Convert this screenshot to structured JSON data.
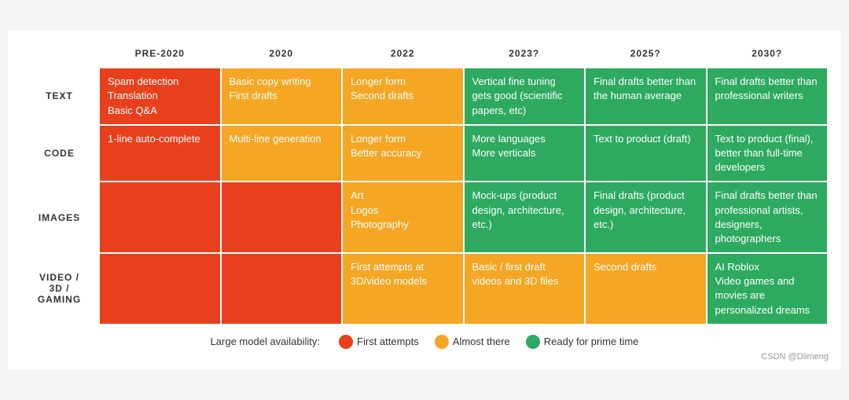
{
  "table": {
    "headers": [
      "PRE-2020",
      "2020",
      "2022",
      "2023?",
      "2025?",
      "2030?"
    ],
    "rows": [
      {
        "label": "TEXT",
        "cells": [
          {
            "color": "red",
            "text": "Spam detection\nTranslation\nBasic Q&A"
          },
          {
            "color": "orange",
            "text": "Basic copy writing\nFirst drafts"
          },
          {
            "color": "orange",
            "text": "Longer form\nSecond drafts"
          },
          {
            "color": "green",
            "text": "Vertical fine tuning gets good (scientific papers, etc)"
          },
          {
            "color": "green",
            "text": "Final drafts better than the human average"
          },
          {
            "color": "green",
            "text": "Final drafts better than professional writers"
          }
        ]
      },
      {
        "label": "CODE",
        "cells": [
          {
            "color": "red",
            "text": "1-line auto-complete"
          },
          {
            "color": "orange",
            "text": "Multi-line generation"
          },
          {
            "color": "orange",
            "text": "Longer form\nBetter accuracy"
          },
          {
            "color": "green",
            "text": "More languages\nMore verticals"
          },
          {
            "color": "green",
            "text": "Text to product (draft)"
          },
          {
            "color": "green",
            "text": "Text to product (final), better than full-time developers"
          }
        ]
      },
      {
        "label": "IMAGES",
        "cells": [
          {
            "color": "red",
            "text": ""
          },
          {
            "color": "red",
            "text": ""
          },
          {
            "color": "orange",
            "text": "Art\nLogos\nPhotography"
          },
          {
            "color": "green",
            "text": "Mock-ups (product design, architecture, etc.)"
          },
          {
            "color": "green",
            "text": "Final drafts (product design, architecture, etc.)"
          },
          {
            "color": "green",
            "text": "Final drafts better than professional artists, designers, photographers"
          }
        ]
      },
      {
        "label": "VIDEO /\n3D /\nGAMING",
        "cells": [
          {
            "color": "red",
            "text": ""
          },
          {
            "color": "red",
            "text": ""
          },
          {
            "color": "orange",
            "text": "First attempts at 3D/video models"
          },
          {
            "color": "orange",
            "text": "Basic / first draft videos and 3D files"
          },
          {
            "color": "orange",
            "text": "Second drafts"
          },
          {
            "color": "green",
            "text": "AI Roblox\nVideo games and movies are personalized dreams"
          }
        ]
      }
    ]
  },
  "legend": {
    "prefix": "Large model availability:",
    "items": [
      {
        "label": "First attempts",
        "color": "#e8401c"
      },
      {
        "label": "Almost there",
        "color": "#f5a623"
      },
      {
        "label": "Ready for prime time",
        "color": "#2daa5f"
      }
    ]
  },
  "attribution": "CSDN @Dlimeng"
}
